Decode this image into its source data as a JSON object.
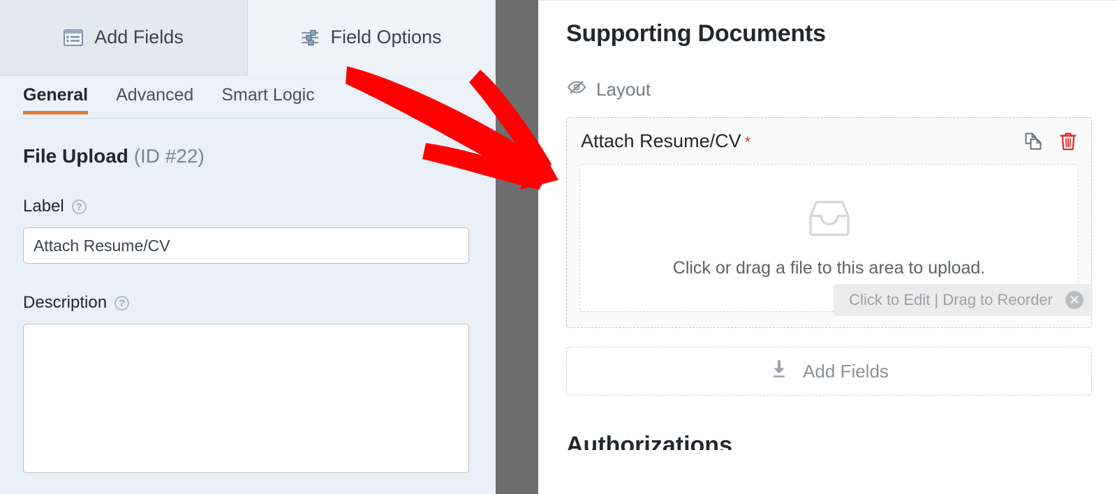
{
  "left_panel": {
    "tabs": [
      {
        "label": "Add Fields",
        "icon": "form-list-icon",
        "active": false
      },
      {
        "label": "Field Options",
        "icon": "sliders-icon",
        "active": true
      }
    ],
    "subtabs": [
      {
        "label": "General",
        "active": true
      },
      {
        "label": "Advanced",
        "active": false
      },
      {
        "label": "Smart Logic",
        "active": false
      }
    ],
    "field_heading": {
      "type": "File Upload",
      "id": "(ID #22)"
    },
    "label_field": {
      "label": "Label",
      "help_icon": "help-circle-icon",
      "value": "Attach Resume/CV",
      "placeholder": ""
    },
    "description_field": {
      "label": "Description",
      "help_icon": "help-circle-icon",
      "value": "",
      "placeholder": ""
    }
  },
  "preview": {
    "title": "Supporting Documents",
    "layout_row": {
      "icon": "eye-slash-icon",
      "label": "Layout"
    },
    "field": {
      "label": "Attach Resume/CV",
      "required_marker": "*",
      "actions": [
        {
          "name": "duplicate-icon",
          "title": "Duplicate"
        },
        {
          "name": "trash-icon",
          "title": "Delete"
        }
      ],
      "dropzone": {
        "icon": "inbox-tray-icon",
        "text": "Click or drag a file to this area to upload."
      },
      "edit_tip": {
        "text": "Click to Edit | Drag to Reorder",
        "close_icon": "close-circle-icon",
        "close_label": "✕"
      }
    },
    "add_fields_drop": {
      "icon": "download-arrow-icon",
      "label": "Add Fields"
    },
    "next_section_heading": "Authorizations"
  },
  "annotation": {
    "type": "red-arrow",
    "color": "#ff0000",
    "points_to": "field-row-attach-resume-cv"
  },
  "colors": {
    "accent_orange": "#e27730",
    "required_red": "#d63638",
    "delete_red": "#e02b2b",
    "panel_bg": "#e9f0f8",
    "divider_gray": "#6e6e6e",
    "annotation_red": "#ff0000"
  }
}
